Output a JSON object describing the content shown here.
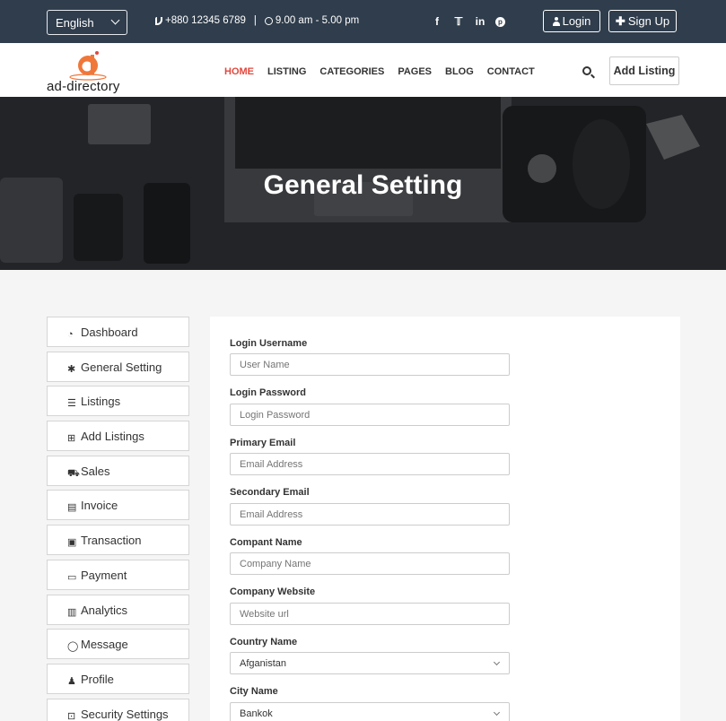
{
  "topbar": {
    "language": "English",
    "phone": "+880 12345 6789",
    "separator": "|",
    "hours": "9.00 am - 5.00 pm",
    "socials": [
      "facebook-icon",
      "twitter-icon",
      "linkedin-icon",
      "pinterest-icon"
    ],
    "login_label": "Login",
    "signup_label": "Sign Up"
  },
  "header": {
    "logo_text": "ad-directory",
    "nav": [
      "HOME",
      "LISTING",
      "CATEGORIES",
      "PAGES",
      "BLOG",
      "CONTACT"
    ],
    "active_nav": "HOME",
    "add_listing_label": "Add Listing"
  },
  "hero": {
    "title": "General Setting"
  },
  "sidebar": {
    "items": [
      {
        "label": "Dashboard",
        "icon": "dashboard-icon"
      },
      {
        "label": "General Setting",
        "icon": "gear-icon"
      },
      {
        "label": "Listings",
        "icon": "list-icon"
      },
      {
        "label": "Add Listings",
        "icon": "plus-square-icon"
      },
      {
        "label": "Sales",
        "icon": "cart-icon"
      },
      {
        "label": "Invoice",
        "icon": "file-icon"
      },
      {
        "label": "Transaction",
        "icon": "money-icon"
      },
      {
        "label": "Payment",
        "icon": "credit-card-icon"
      },
      {
        "label": "Analytics",
        "icon": "bar-chart-icon"
      },
      {
        "label": "Message",
        "icon": "comment-icon"
      },
      {
        "label": "Profile",
        "icon": "user-icon"
      },
      {
        "label": "Security Settings",
        "icon": "lock-icon"
      }
    ]
  },
  "form": {
    "fields": [
      {
        "label": "Login Username",
        "placeholder": "User Name"
      },
      {
        "label": "Login Password",
        "placeholder": "Login Password"
      },
      {
        "label": "Primary Email",
        "placeholder": "Email Address"
      },
      {
        "label": "Secondary Email",
        "placeholder": "Email Address"
      },
      {
        "label": "Compant Name",
        "placeholder": "Company Name"
      },
      {
        "label": "Company Website",
        "placeholder": "Website url"
      }
    ],
    "country": {
      "label": "Country Name",
      "value": "Afganistan"
    },
    "city": {
      "label": "City Name",
      "value": "Bankok"
    }
  },
  "colors": {
    "topbar_bg": "#2f3d4c",
    "accent": "#e2483d",
    "hero_overlay": "#2d2e32"
  }
}
